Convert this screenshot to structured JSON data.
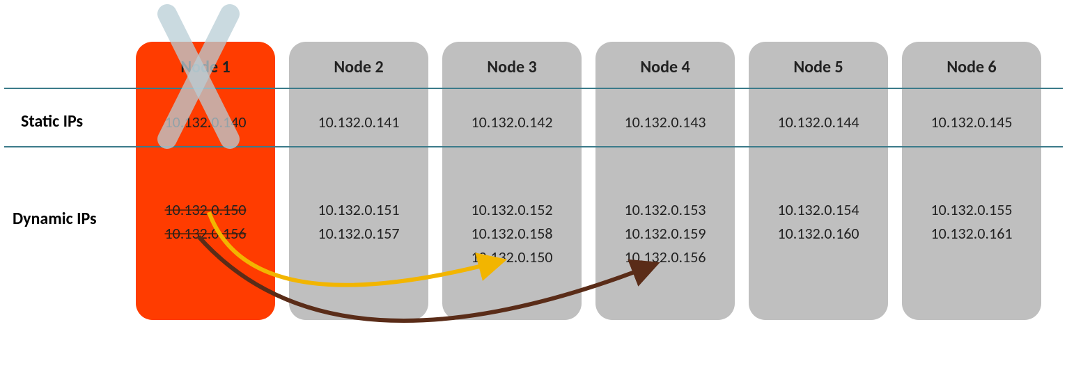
{
  "rows": {
    "static_label": "Static IPs",
    "dynamic_label": "Dynamic IPs"
  },
  "nodes": [
    {
      "name": "Node 1",
      "failed": true,
      "static_ip": "10.132.0.140",
      "dynamic_ips": [
        "10.132.0.150",
        "10.132.0.156"
      ]
    },
    {
      "name": "Node 2",
      "failed": false,
      "static_ip": "10.132.0.141",
      "dynamic_ips": [
        "10.132.0.151",
        "10.132.0.157"
      ]
    },
    {
      "name": "Node 3",
      "failed": false,
      "static_ip": "10.132.0.142",
      "dynamic_ips": [
        "10.132.0.152",
        "10.132.0.158",
        "10.132.0.150"
      ]
    },
    {
      "name": "Node 4",
      "failed": false,
      "static_ip": "10.132.0.143",
      "dynamic_ips": [
        "10.132.0.153",
        "10.132.0.159",
        "10.132.0.156"
      ]
    },
    {
      "name": "Node 5",
      "failed": false,
      "static_ip": "10.132.0.144",
      "dynamic_ips": [
        "10.132.0.154",
        "10.132.0.160"
      ]
    },
    {
      "name": "Node 6",
      "failed": false,
      "static_ip": "10.132.0.145",
      "dynamic_ips": [
        "10.132.0.155",
        "10.132.0.161"
      ]
    }
  ],
  "arrows": [
    {
      "from": "Node 1",
      "ip": "10.132.0.150",
      "to": "Node 3",
      "color": "#f2b500"
    },
    {
      "from": "Node 1",
      "ip": "10.132.0.156",
      "to": "Node 4",
      "color": "#5a2c18"
    }
  ]
}
